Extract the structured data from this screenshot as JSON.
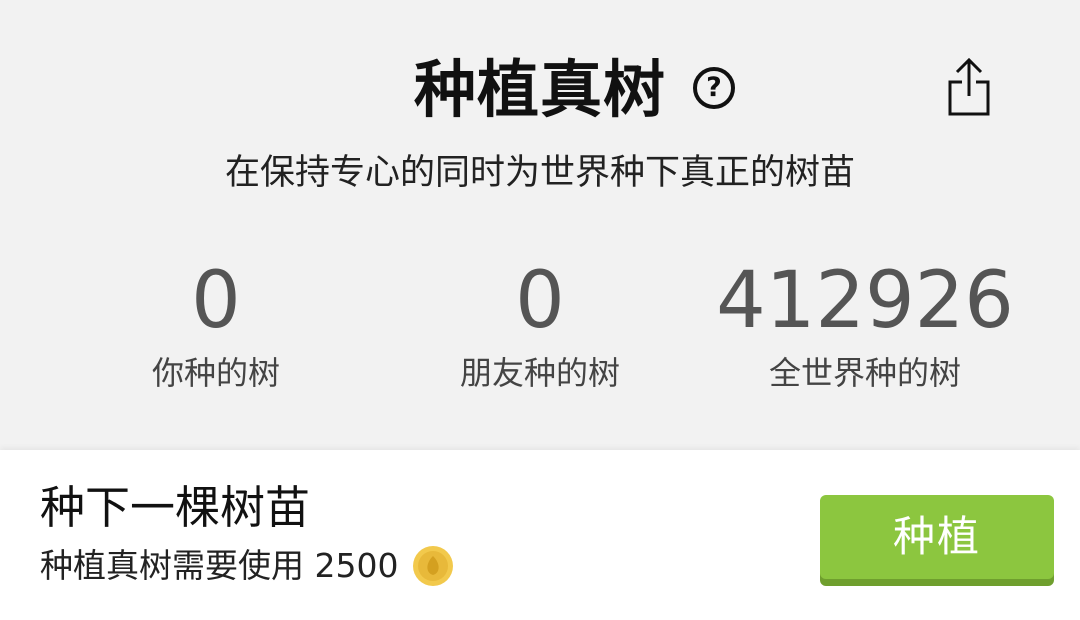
{
  "header": {
    "title": "种植真树",
    "help_icon": "question-circle-icon",
    "help_symbol": "?",
    "share_icon": "share-icon",
    "subtitle": "在保持专心的同时为世界种下真正的树苗"
  },
  "stats": [
    {
      "value": "0",
      "label": "你种的树"
    },
    {
      "value": "0",
      "label": "朋友种的树"
    },
    {
      "value": "412926",
      "label": "全世界种的树"
    }
  ],
  "plant": {
    "title": "种下一棵树苗",
    "cost_text": "种植真树需要使用 2500",
    "coin_icon": "coin-icon",
    "button_label": "种植"
  },
  "colors": {
    "accent": "#8cc63f",
    "accent_shadow": "#6f9f2e",
    "coin": "#f2c94c"
  }
}
